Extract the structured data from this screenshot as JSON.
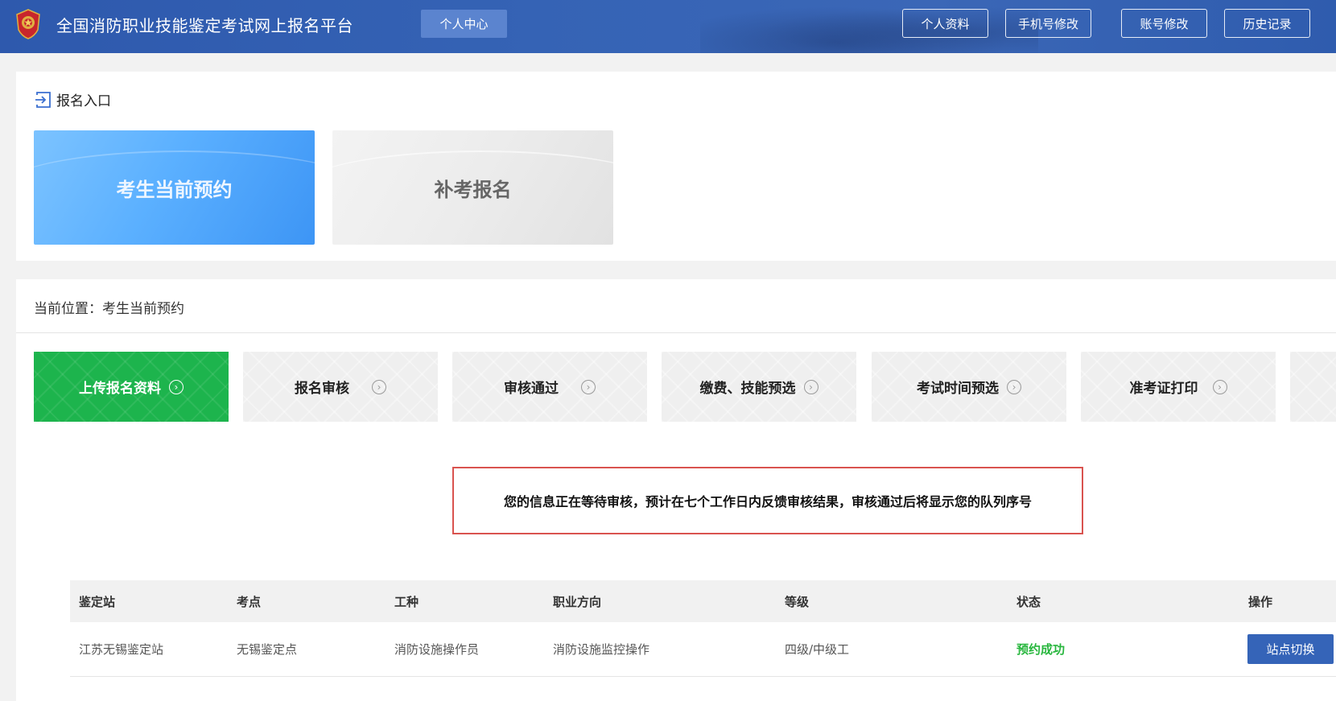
{
  "header": {
    "site_title": "全国消防职业技能鉴定考试网上报名平台",
    "center_button": "个人中心",
    "nav_buttons": [
      "个人资料",
      "手机号修改",
      "账号修改",
      "历史记录"
    ],
    "bg_color": "#3563b5"
  },
  "entry": {
    "heading": "报名入口",
    "cards": [
      "考生当前预约",
      "补考报名"
    ]
  },
  "flow": {
    "location_label": "当前位置：",
    "location_value": "考生当前预约",
    "steps": [
      "上传报名资料",
      "报名审核",
      "审核通过",
      "缴费、技能预选",
      "考试时间预选",
      "准考证打印"
    ],
    "current_step_color": "#1db44d",
    "notice": "您的信息正在等待审核，预计在七个工作日内反馈审核结果，审核通过后将显示您的队列序号",
    "notice_border_color": "#d9534f"
  },
  "table": {
    "headers": [
      "鉴定站",
      "考点",
      "工种",
      "职业方向",
      "等级",
      "状态",
      "操作"
    ],
    "rows": [
      {
        "station": "江苏无锡鉴定站",
        "site": "无锡鉴定点",
        "trade": "消防设施操作员",
        "direction": "消防设施监控操作",
        "level": "四级/中级工",
        "status": "预约成功",
        "action": "站点切换"
      }
    ],
    "status_color": "#27b63d"
  },
  "icons": {
    "emblem": "fire-rescue-emblem-icon",
    "entry": "enter-icon",
    "step_arrow": "chevron-right-circle-icon"
  }
}
